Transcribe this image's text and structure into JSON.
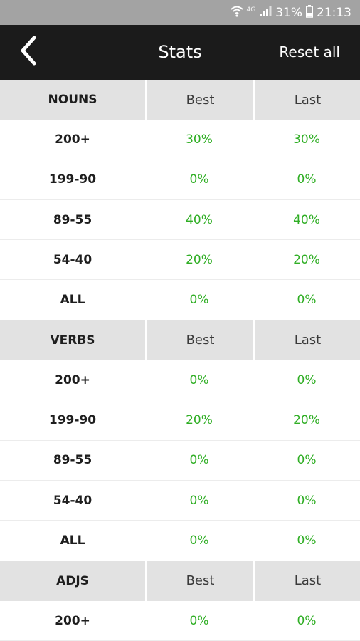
{
  "status_bar": {
    "battery": "31%",
    "time": "21:13",
    "network_label": "4G"
  },
  "header": {
    "back_icon": "chevron-left-icon",
    "title": "Stats",
    "reset_label": "Reset all"
  },
  "colors": {
    "status_bar": "#a3a3a3",
    "app_bar": "#1b1b1b",
    "section_header": "#e2e2e2",
    "value_green": "#2fae24"
  },
  "sections": [
    {
      "name": "NOUNS",
      "best_label": "Best",
      "last_label": "Last",
      "rows": [
        {
          "range": "200+",
          "best": "30%",
          "last": "30%"
        },
        {
          "range": "199-90",
          "best": "0%",
          "last": "0%"
        },
        {
          "range": "89-55",
          "best": "40%",
          "last": "40%"
        },
        {
          "range": "54-40",
          "best": "20%",
          "last": "20%"
        },
        {
          "range": "ALL",
          "best": "0%",
          "last": "0%"
        }
      ]
    },
    {
      "name": "VERBS",
      "best_label": "Best",
      "last_label": "Last",
      "rows": [
        {
          "range": "200+",
          "best": "0%",
          "last": "0%"
        },
        {
          "range": "199-90",
          "best": "20%",
          "last": "20%"
        },
        {
          "range": "89-55",
          "best": "0%",
          "last": "0%"
        },
        {
          "range": "54-40",
          "best": "0%",
          "last": "0%"
        },
        {
          "range": "ALL",
          "best": "0%",
          "last": "0%"
        }
      ]
    },
    {
      "name": "ADJS",
      "best_label": "Best",
      "last_label": "Last",
      "rows": [
        {
          "range": "200+",
          "best": "0%",
          "last": "0%"
        }
      ]
    }
  ]
}
